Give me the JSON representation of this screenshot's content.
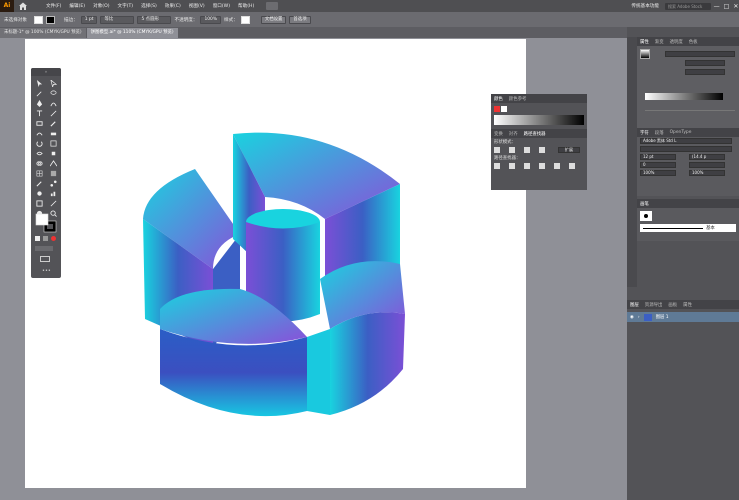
{
  "app": {
    "logo": "Ai",
    "home_icon": "home-icon"
  },
  "menu": [
    "文件(F)",
    "编辑(E)",
    "对象(O)",
    "文字(T)",
    "选择(S)",
    "效果(C)",
    "视图(V)",
    "窗口(W)",
    "帮助(H)"
  ],
  "essentials": "传统基本功能",
  "search_placeholder": "搜索 Adobe Stock",
  "window_controls": [
    "—",
    "□",
    "✕"
  ],
  "controlbar": {
    "selection": "未选择对象",
    "stroke_label": "描边：",
    "stroke_value": "1 pt",
    "uniform": "等比",
    "brush": "5 点圆形",
    "opacity_label": "不透明度：",
    "opacity_value": "100%",
    "style_label": "样式：",
    "doc_setup": "文档设置",
    "preferences": "首选项"
  },
  "tabs": [
    {
      "label": "未标题-1* @ 100% (CMYK/GPU 预览)",
      "active": false
    },
    {
      "label": "饼图模型.ai* @ 110% (CMYK/GPU 预览)",
      "active": true
    }
  ],
  "color_panel": {
    "tabs": [
      "颜色",
      "颜色参考"
    ],
    "subtabs": [
      "变换",
      "对齐",
      "路径查找器"
    ],
    "shape_modes": "形状模式：",
    "pathfinders": "路径查找器：",
    "expand": "扩展"
  },
  "right_dock": {
    "top_tabs": [
      "属性",
      "渐变",
      "透明度",
      "色板"
    ],
    "char_tabs": [
      "字符",
      "段落",
      "OpenType"
    ],
    "font": "Adobe 黑体 Std L",
    "font_size": "12 pt",
    "leading": "(14.4 p",
    "tracking": "0",
    "scale_h": "100%",
    "scale_v": "100%",
    "stroke_tab": "画笔",
    "stroke_basic": "基本",
    "layers_tabs": [
      "图层",
      "资源导出",
      "画板",
      "属性"
    ],
    "layer_name": "图层 1"
  },
  "colors": {
    "cyan": "#19d3df",
    "purple": "#8a4fd9",
    "blue": "#3b5fc4"
  }
}
